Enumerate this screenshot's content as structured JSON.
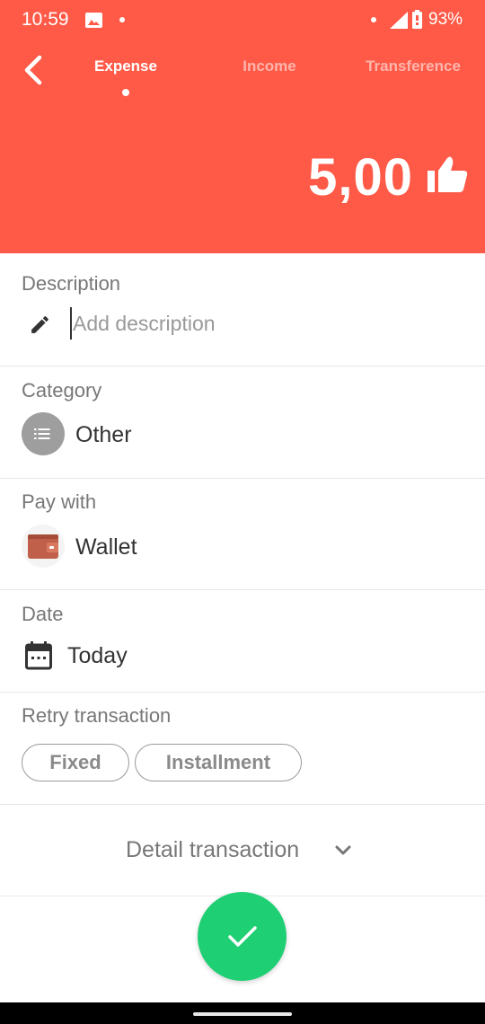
{
  "status_bar": {
    "time": "10:59",
    "battery": "93%",
    "icons": [
      "image-icon",
      "notification-dot",
      "signal-icon",
      "battery-icon"
    ]
  },
  "header": {
    "tabs": [
      {
        "label": "Expense",
        "active": true
      },
      {
        "label": "Income",
        "active": false
      },
      {
        "label": "Transference",
        "active": false
      }
    ],
    "amount": "5,00",
    "background_color": "#fe5a47"
  },
  "description": {
    "label": "Description",
    "placeholder": "Add description",
    "value": ""
  },
  "category": {
    "label": "Category",
    "value": "Other",
    "icon": "list-icon"
  },
  "pay_with": {
    "label": "Pay with",
    "value": "Wallet",
    "icon": "wallet-icon"
  },
  "date": {
    "label": "Date",
    "value": "Today",
    "icon": "calendar-icon"
  },
  "retry": {
    "label": "Retry transaction",
    "options": [
      "Fixed",
      "Installment"
    ]
  },
  "detail": {
    "label": "Detail transaction"
  },
  "confirm": {
    "icon": "check-icon",
    "color": "#1fcf74"
  }
}
